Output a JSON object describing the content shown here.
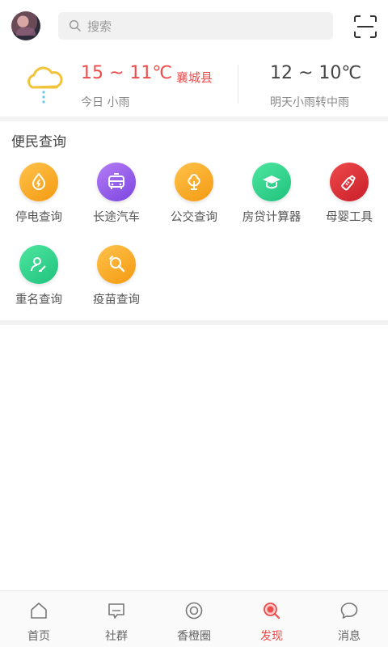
{
  "header": {
    "search_placeholder": "搜索",
    "avatar_icon": "user-avatar",
    "scan_icon": "scan-icon"
  },
  "weather": {
    "today_temp": "15 ~ 11℃",
    "city": "襄城县",
    "today_desc": "今日 小雨",
    "tomorrow_temp": "12 ~ 10℃",
    "tomorrow_desc": "明天小雨转中雨",
    "icon": "cloud-rain-icon"
  },
  "section": {
    "title": "便民查询",
    "tools": [
      {
        "label": "停电查询",
        "icon": "power-outage-icon",
        "color": "#f7a41d"
      },
      {
        "label": "长途汽车",
        "icon": "bus-icon",
        "color": "#9b59e8"
      },
      {
        "label": "公交查询",
        "icon": "tree-icon",
        "color": "#f7a41d"
      },
      {
        "label": "房贷计算器",
        "icon": "graduation-cap-icon",
        "color": "#2bd48a"
      },
      {
        "label": "母婴工具",
        "icon": "baby-bottle-icon",
        "color": "#e23838"
      },
      {
        "label": "重名查询",
        "icon": "name-search-icon",
        "color": "#2bd48a"
      },
      {
        "label": "疫苗查询",
        "icon": "vaccine-icon",
        "color": "#f7a41d"
      }
    ]
  },
  "nav": {
    "items": [
      {
        "label": "首页",
        "icon": "home-icon"
      },
      {
        "label": "社群",
        "icon": "chat-bubble-icon"
      },
      {
        "label": "香橙圈",
        "icon": "ring-icon"
      },
      {
        "label": "发现",
        "icon": "search-discover-icon"
      },
      {
        "label": "消息",
        "icon": "message-icon"
      }
    ],
    "active": "发现",
    "accent": "#ee4b4b"
  }
}
